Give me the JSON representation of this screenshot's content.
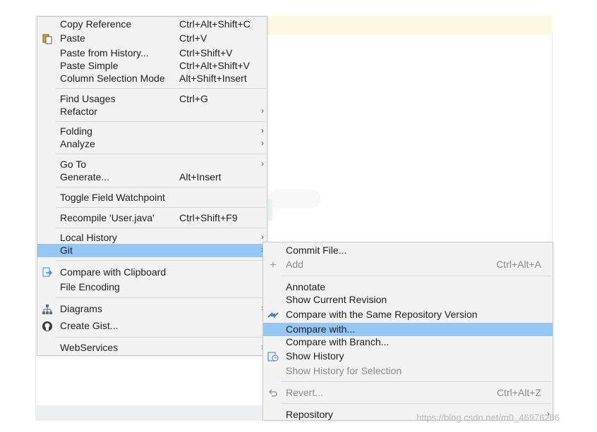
{
  "main_menu": {
    "items": [
      {
        "label": "Copy Reference",
        "shortcut": "Ctrl+Alt+Shift+C"
      },
      {
        "label": "Paste",
        "shortcut": "Ctrl+V",
        "icon": "paste-icon"
      },
      {
        "label": "Paste from History...",
        "shortcut": "Ctrl+Shift+V"
      },
      {
        "label": "Paste Simple",
        "shortcut": "Ctrl+Alt+Shift+V"
      },
      {
        "label": "Column Selection Mode",
        "shortcut": "Alt+Shift+Insert"
      },
      {
        "label": "Find Usages",
        "shortcut": "Ctrl+G"
      },
      {
        "label": "Refactor",
        "submenu_arrow": "›"
      },
      {
        "label": "Folding",
        "submenu_arrow": "›"
      },
      {
        "label": "Analyze",
        "submenu_arrow": "›"
      },
      {
        "label": "Go To",
        "submenu_arrow": "›"
      },
      {
        "label": "Generate...",
        "shortcut": "Alt+Insert"
      },
      {
        "label": "Toggle Field Watchpoint"
      },
      {
        "label": "Recompile 'User.java'",
        "shortcut": "Ctrl+Shift+F9"
      },
      {
        "label": "Local History",
        "submenu_arrow": "›"
      },
      {
        "label": "Git",
        "submenu_arrow": "›",
        "selected": true
      },
      {
        "label": "Compare with Clipboard",
        "icon": "compare-clipboard-icon"
      },
      {
        "label": "File Encoding"
      },
      {
        "label": "Diagrams",
        "icon": "diagrams-icon",
        "submenu_arrow": "›"
      },
      {
        "label": "Create Gist...",
        "icon": "github-icon"
      },
      {
        "label": "WebServices",
        "submenu_arrow": "›"
      }
    ]
  },
  "git_submenu": {
    "items": [
      {
        "label": "Commit File..."
      },
      {
        "label": "Add",
        "shortcut": "Ctrl+Alt+A",
        "icon": "plus-icon",
        "disabled": true
      },
      {
        "label": "Annotate"
      },
      {
        "label": "Show Current Revision"
      },
      {
        "label": "Compare with the Same Repository Version",
        "icon": "diff-arrows-icon"
      },
      {
        "label": "Compare with...",
        "selected": true
      },
      {
        "label": "Compare with Branch..."
      },
      {
        "label": "Show History",
        "icon": "history-icon"
      },
      {
        "label": "Show History for Selection",
        "disabled": true
      },
      {
        "label": "Revert...",
        "shortcut": "Ctrl+Alt+Z",
        "icon": "revert-icon",
        "disabled": true
      },
      {
        "label": "Repository",
        "submenu_arrow": "›"
      }
    ]
  },
  "watermark": "https://blog.csdn.net/m0_46976286",
  "colors": {
    "menu_bg": "#f2f2f2",
    "selection": "#94c7f4",
    "editor_highlight": "#fdf8e2",
    "disabled_text": "#8a8a8a"
  }
}
